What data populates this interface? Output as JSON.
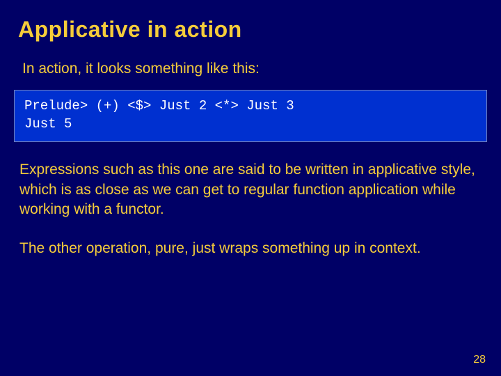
{
  "title": "Applicative in action",
  "intro": "In action, it looks something like this:",
  "code_line1": "Prelude> (+) <$> Just 2 <*> Just 3",
  "code_line2": "Just 5",
  "para1": "Expressions such as this one are said to be written in applicative style, which is as close as we can get to regular function application while working with a functor.",
  "para2": "The other operation, pure, just wraps something up in context.",
  "page_number": "28"
}
